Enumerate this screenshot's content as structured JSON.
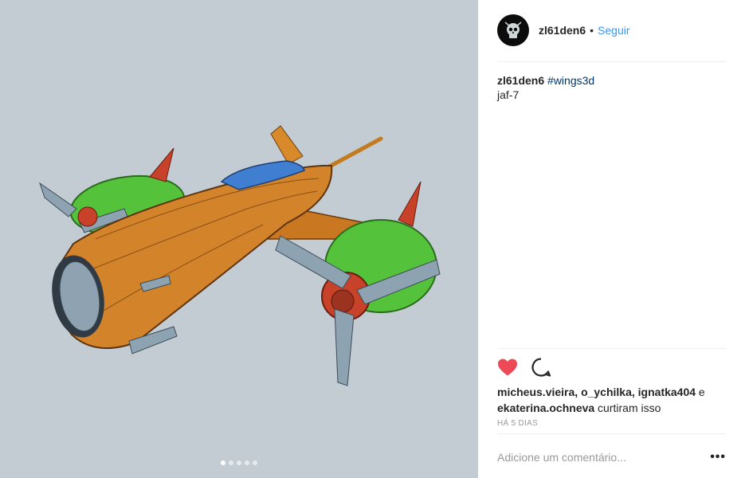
{
  "post": {
    "image_alt": "jaf-7",
    "carousel": {
      "count": 5,
      "active": 0
    }
  },
  "author": {
    "username": "zl61den6",
    "separator": "•",
    "follow_label": "Seguir"
  },
  "caption": {
    "username": "zl61den6",
    "hashtag": "#wings3d",
    "text": "jaf-7"
  },
  "likes": {
    "users": [
      "micheus.vieira",
      "o_ychilka",
      "ignatka404",
      "ekaterina.ochneva"
    ],
    "sep1": ", ",
    "sep2": ", ",
    "sep3": " e ",
    "suffix": " curtiram isso"
  },
  "timestamp": "Há 5 dias",
  "comment": {
    "placeholder": "Adicione um comentário..."
  },
  "icons": {
    "like": "heart-icon",
    "comment": "comment-bubble-icon",
    "more": "more-options-icon"
  },
  "colors": {
    "like": "#ed4956",
    "link": "#3897f0",
    "hashtag": "#003569",
    "media_bg": "#c3ccd3"
  }
}
